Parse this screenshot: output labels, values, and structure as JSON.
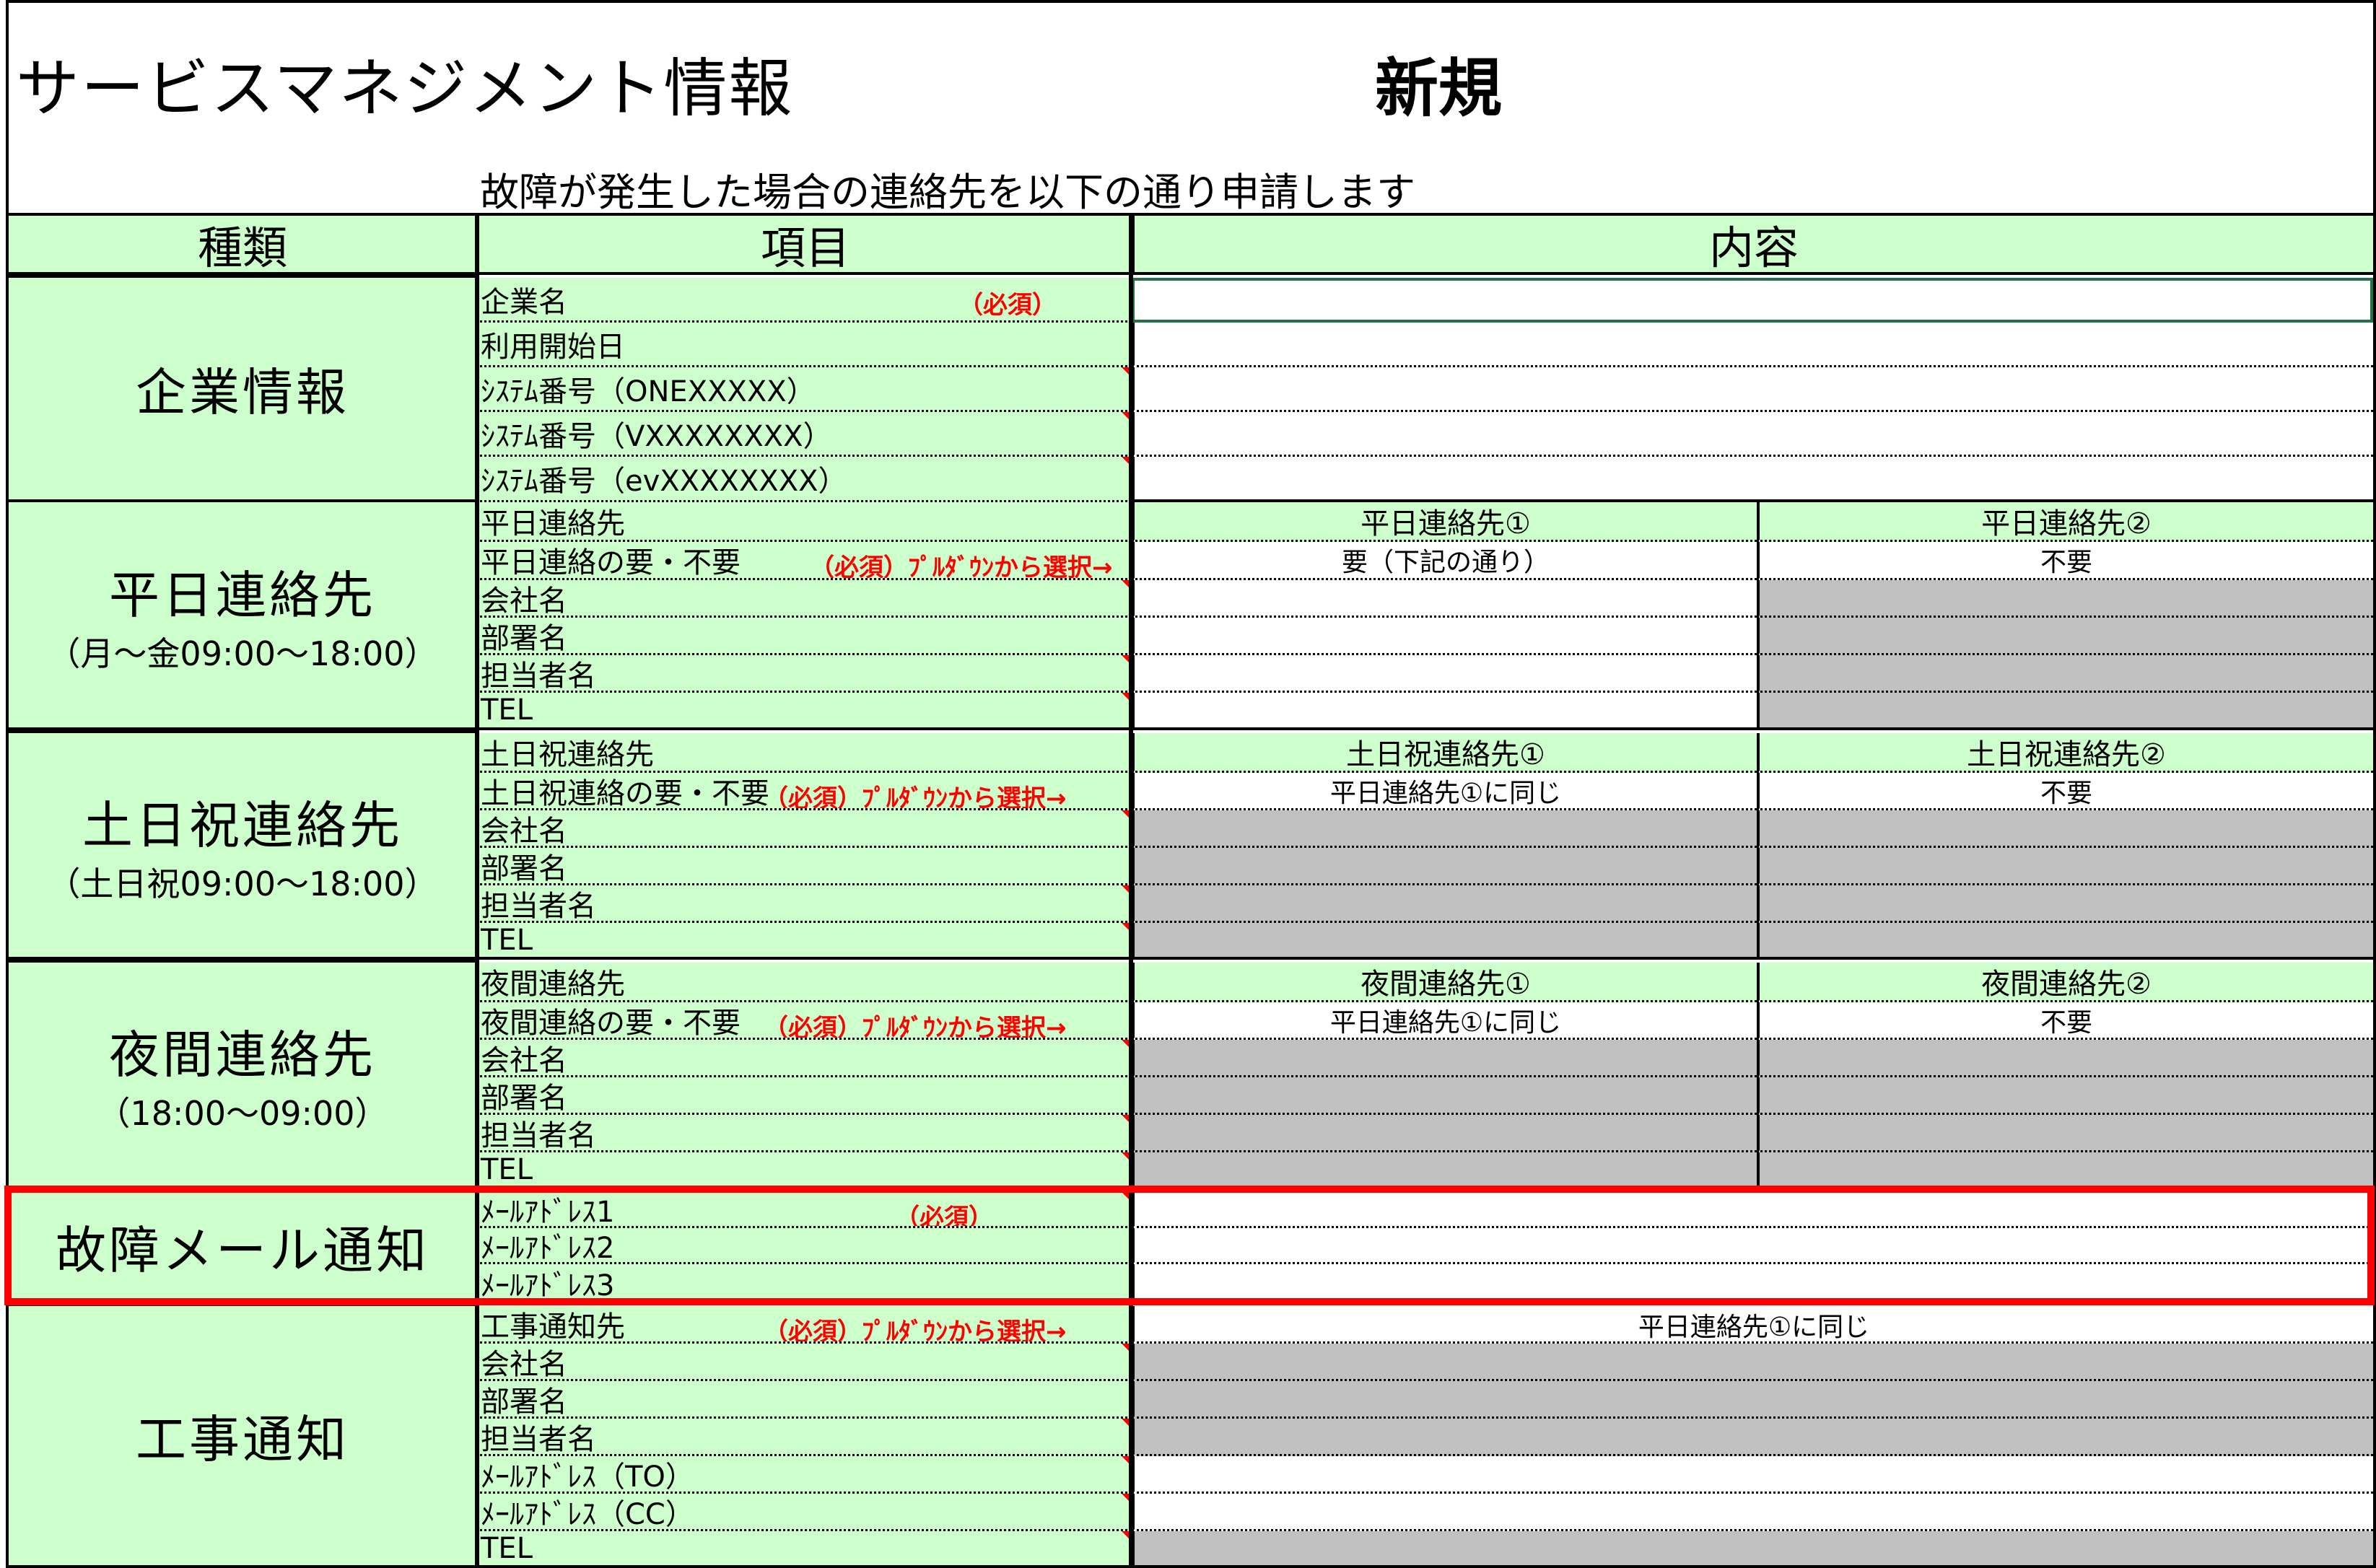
{
  "title": "サービスマネジメント情報",
  "status": "新規",
  "subtitle": "故障が発生した場合の連絡先を以下の通り申請します",
  "headers": {
    "type": "種類",
    "item": "項目",
    "content": "内容"
  },
  "required_mark": "（必須）",
  "dropdown_note": "（必須）ﾌﾟﾙﾀﾞｳﾝから選択→",
  "company": {
    "category": "企業情報",
    "rows": [
      "企業名",
      "利用開始日",
      "ｼｽﾃﾑ番号（ONEXXXXX）",
      "ｼｽﾃﾑ番号（VXXXXXXXX）",
      "ｼｽﾃﾑ番号（evXXXXXXXX）"
    ]
  },
  "weekday": {
    "category": "平日連絡先",
    "sub": "（月～金09:00～18:00）",
    "rows": [
      "平日連絡先",
      "平日連絡の要・不要",
      "会社名",
      "部署名",
      "担当者名",
      "TEL"
    ],
    "col1": "平日連絡先①",
    "col2": "平日連絡先②",
    "val1": "要（下記の通り）",
    "val2": "不要"
  },
  "holiday": {
    "category": "土日祝連絡先",
    "sub": "（土日祝09:00～18:00）",
    "rows": [
      "土日祝連絡先",
      "土日祝連絡の要・不要",
      "会社名",
      "部署名",
      "担当者名",
      "TEL"
    ],
    "col1": "土日祝連絡先①",
    "col2": "土日祝連絡先②",
    "val1": "平日連絡先①に同じ",
    "val2": "不要"
  },
  "night": {
    "category": "夜間連絡先",
    "sub": "（18:00～09:00）",
    "rows": [
      "夜間連絡先",
      "夜間連絡の要・不要",
      "会社名",
      "部署名",
      "担当者名",
      "TEL"
    ],
    "col1": "夜間連絡先①",
    "col2": "夜間連絡先②",
    "val1": "平日連絡先①に同じ",
    "val2": "不要"
  },
  "mail": {
    "category": "故障メール通知",
    "rows": [
      "ﾒｰﾙｱﾄﾞﾚｽ1",
      "ﾒｰﾙｱﾄﾞﾚｽ2",
      "ﾒｰﾙｱﾄﾞﾚｽ3"
    ]
  },
  "construction": {
    "category": "工事通知",
    "rows": [
      "工事通知先",
      "会社名",
      "部署名",
      "担当者名",
      "ﾒｰﾙｱﾄﾞﾚｽ（TO）",
      "ﾒｰﾙｱﾄﾞﾚｽ（CC）",
      "TEL"
    ],
    "val": "平日連絡先①に同じ"
  },
  "colors": {
    "header_green": "#ccffcc",
    "grey": "#c0c0c0",
    "required_red": "#ff0000",
    "highlight": "#ff0000"
  }
}
